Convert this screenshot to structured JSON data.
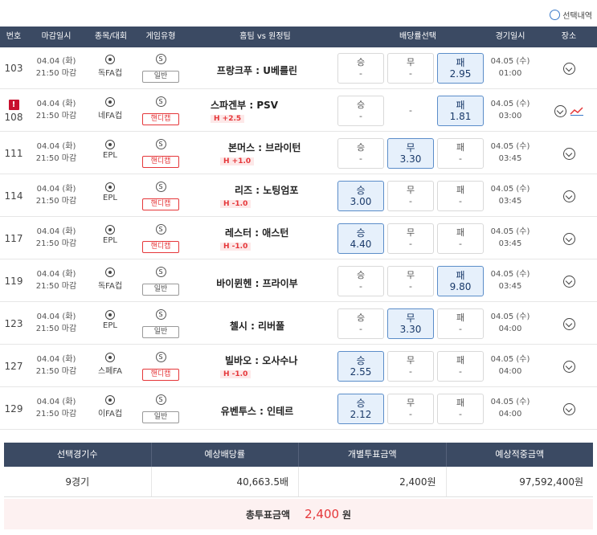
{
  "toggle": {
    "label": "선택내역"
  },
  "header": {
    "no": "번호",
    "deadline": "마감일시",
    "league": "종목/대회",
    "type": "게임유형",
    "match": "홈팀 vs 원정팀",
    "odds": "배당률선택",
    "date": "경기일시",
    "venue": "장소"
  },
  "rows": [
    {
      "no": "103",
      "deadline_date": "04.04 (화)",
      "deadline_time": "21:50 마감",
      "league": "독FA컵",
      "s": "S",
      "type": "일반",
      "match": "프랑크푸 : U베를린",
      "handicap": "",
      "win_label": "승",
      "win": "-",
      "draw_label": "무",
      "draw": "-",
      "loss_label": "패",
      "loss": "2.95",
      "date": "04.05 (수)",
      "time": "01:00"
    },
    {
      "no": "108",
      "deadline_date": "04.04 (화)",
      "deadline_time": "21:50 마감",
      "league": "네FA컵",
      "s": "S",
      "type": "핸디캡",
      "match": "스파겐부 : PSV",
      "handicap": "H +2.5",
      "win_label": "승",
      "win": "-",
      "draw": "-",
      "loss_label": "패",
      "loss": "1.81",
      "date": "04.05 (수)",
      "time": "03:00"
    },
    {
      "no": "111",
      "deadline_date": "04.04 (화)",
      "deadline_time": "21:50 마감",
      "league": "EPL",
      "s": "S",
      "type": "핸디캡",
      "match": "본머스 : 브라이턴",
      "handicap": "H +1.0",
      "win_label": "승",
      "win": "-",
      "draw_label": "무",
      "draw": "3.30",
      "loss_label": "패",
      "loss": "-",
      "date": "04.05 (수)",
      "time": "03:45"
    },
    {
      "no": "114",
      "deadline_date": "04.04 (화)",
      "deadline_time": "21:50 마감",
      "league": "EPL",
      "s": "S",
      "type": "핸디캡",
      "match": "리즈 : 노팅엄포",
      "handicap": "H -1.0",
      "win_label": "승",
      "win": "3.00",
      "draw_label": "무",
      "draw": "-",
      "loss_label": "패",
      "loss": "-",
      "date": "04.05 (수)",
      "time": "03:45"
    },
    {
      "no": "117",
      "deadline_date": "04.04 (화)",
      "deadline_time": "21:50 마감",
      "league": "EPL",
      "s": "S",
      "type": "핸디캡",
      "match": "레스터 : 애스턴",
      "handicap": "H -1.0",
      "win_label": "승",
      "win": "4.40",
      "draw_label": "무",
      "draw": "-",
      "loss_label": "패",
      "loss": "-",
      "date": "04.05 (수)",
      "time": "03:45"
    },
    {
      "no": "119",
      "deadline_date": "04.04 (화)",
      "deadline_time": "21:50 마감",
      "league": "독FA컵",
      "s": "S",
      "type": "일반",
      "match": "바이뮌헨 : 프라이부",
      "handicap": "",
      "win_label": "승",
      "win": "-",
      "draw_label": "무",
      "draw": "-",
      "loss_label": "패",
      "loss": "9.80",
      "date": "04.05 (수)",
      "time": "03:45"
    },
    {
      "no": "123",
      "deadline_date": "04.04 (화)",
      "deadline_time": "21:50 마감",
      "league": "EPL",
      "s": "S",
      "type": "일반",
      "match": "첼시 : 리버풀",
      "handicap": "",
      "win_label": "승",
      "win": "-",
      "draw_label": "무",
      "draw": "3.30",
      "loss_label": "패",
      "loss": "-",
      "date": "04.05 (수)",
      "time": "04:00"
    },
    {
      "no": "127",
      "deadline_date": "04.04 (화)",
      "deadline_time": "21:50 마감",
      "league": "스페FA",
      "s": "S",
      "type": "핸디캡",
      "match": "빌바오 : 오사수나",
      "handicap": "H -1.0",
      "win_label": "승",
      "win": "2.55",
      "draw_label": "무",
      "draw": "-",
      "loss_label": "패",
      "loss": "-",
      "date": "04.05 (수)",
      "time": "04:00"
    },
    {
      "no": "129",
      "deadline_date": "04.04 (화)",
      "deadline_time": "21:50 마감",
      "league": "이FA컵",
      "s": "S",
      "type": "일반",
      "match": "유벤투스 : 인테르",
      "handicap": "",
      "win_label": "승",
      "win": "2.12",
      "draw_label": "무",
      "draw": "-",
      "loss_label": "패",
      "loss": "-",
      "date": "04.05 (수)",
      "time": "04:00"
    }
  ],
  "summary": {
    "h_count": "선택경기수",
    "h_odds": "예상배당률",
    "h_stake": "개별투표금액",
    "h_payout": "예상적중금액",
    "count": "9경기",
    "odds": "40,663.5배",
    "stake": "2,400원",
    "payout": "97,592,400원",
    "total_label": "총투표금액",
    "total_amount": "2,400",
    "total_unit": "원"
  }
}
